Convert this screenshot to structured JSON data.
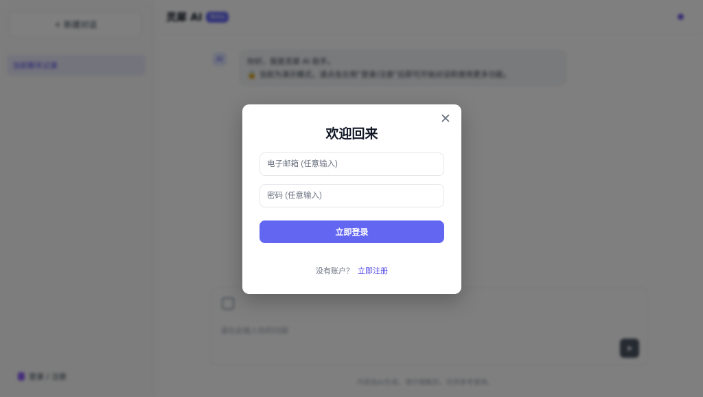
{
  "background": {
    "sidebar": {
      "new_chat_label": "+ 新建对话",
      "conversations": [
        "当前聊天记录"
      ],
      "user_label": "登录 / 注册"
    },
    "header": {
      "title": "灵犀 AI",
      "badge": "Beta"
    },
    "message": {
      "avatar_glyph": "AI",
      "line1": "你好，我是灵犀 AI 助手。",
      "line2": "🔒 当前为演示模式，请点击左侧“登录/注册”后即可开始对话和使用更多功能。"
    },
    "composer": {
      "placeholder": "请在此输入你的问题",
      "send_glyph": "➤"
    },
    "footer": {
      "disclaimer": "内容由AI生成，请仔细甄别，仅供参考使用。"
    }
  },
  "modal": {
    "close_glyph": "✕",
    "title": "欢迎回来",
    "email_placeholder": "电子邮箱 (任意输入)",
    "email_value": "",
    "password_placeholder": "密码 (任意输入)",
    "password_value": "",
    "login_label": "立即登录",
    "no_account_text": "没有账户？",
    "register_label": "立即注册"
  },
  "colors": {
    "accent": "#6366f1",
    "overlay": "rgba(0,0,0,0.5)",
    "modal_bg": "#ffffff"
  }
}
